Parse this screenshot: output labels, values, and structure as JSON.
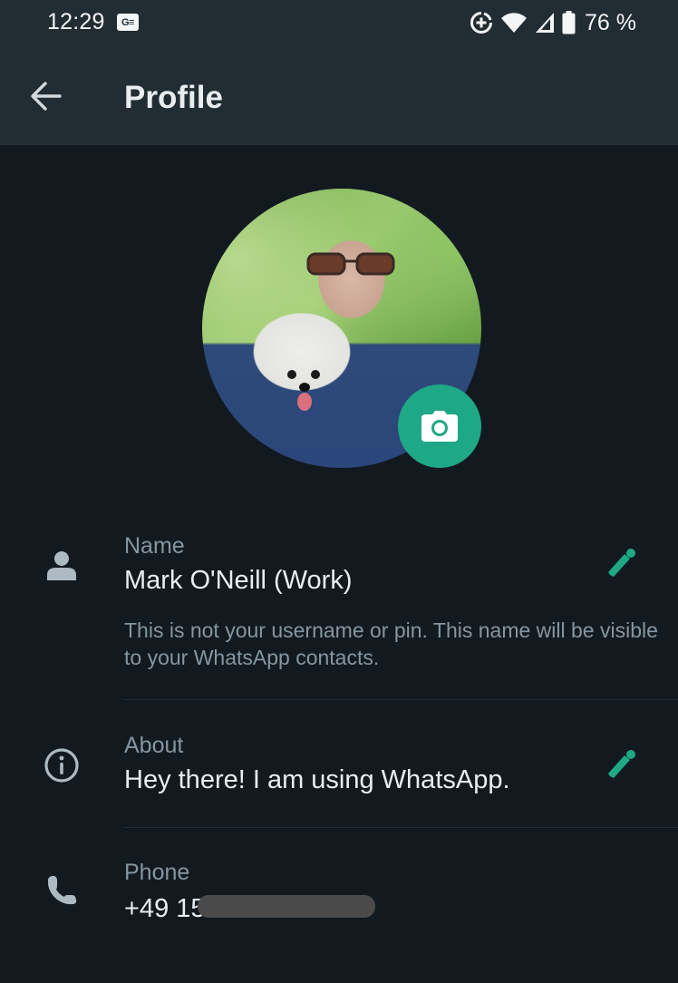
{
  "status_bar": {
    "time": "12:29",
    "notification_badge": "G≡",
    "icons": [
      "data-saver-icon",
      "wifi-icon",
      "cell-signal-icon",
      "battery-icon"
    ],
    "battery_percent": "76 %"
  },
  "app_bar": {
    "back_icon": "arrow-left-icon",
    "title": "Profile"
  },
  "avatar": {
    "alt": "Profile photo of a man with sunglasses holding a small white dog",
    "camera_icon": "camera-icon"
  },
  "fields": {
    "name": {
      "icon": "person-icon",
      "label": "Name",
      "value": "Mark O'Neill (Work)",
      "hint": "This is not your username or pin. This name will be visible to your WhatsApp contacts.",
      "edit_icon": "pencil-icon"
    },
    "about": {
      "icon": "info-icon",
      "label": "About",
      "value": "Hey there! I am using WhatsApp.",
      "edit_icon": "pencil-icon"
    },
    "phone": {
      "icon": "phone-icon",
      "label": "Phone",
      "value": "+49 15•• ••••••••",
      "visible_prefix": "+49 15",
      "redacted": true
    }
  },
  "colors": {
    "app_bar_bg": "#222c33",
    "body_bg": "#121a20",
    "accent": "#1fa885",
    "label_gray": "#8696a0",
    "text_primary": "#e9edef",
    "icon_gray": "#aebac1"
  }
}
